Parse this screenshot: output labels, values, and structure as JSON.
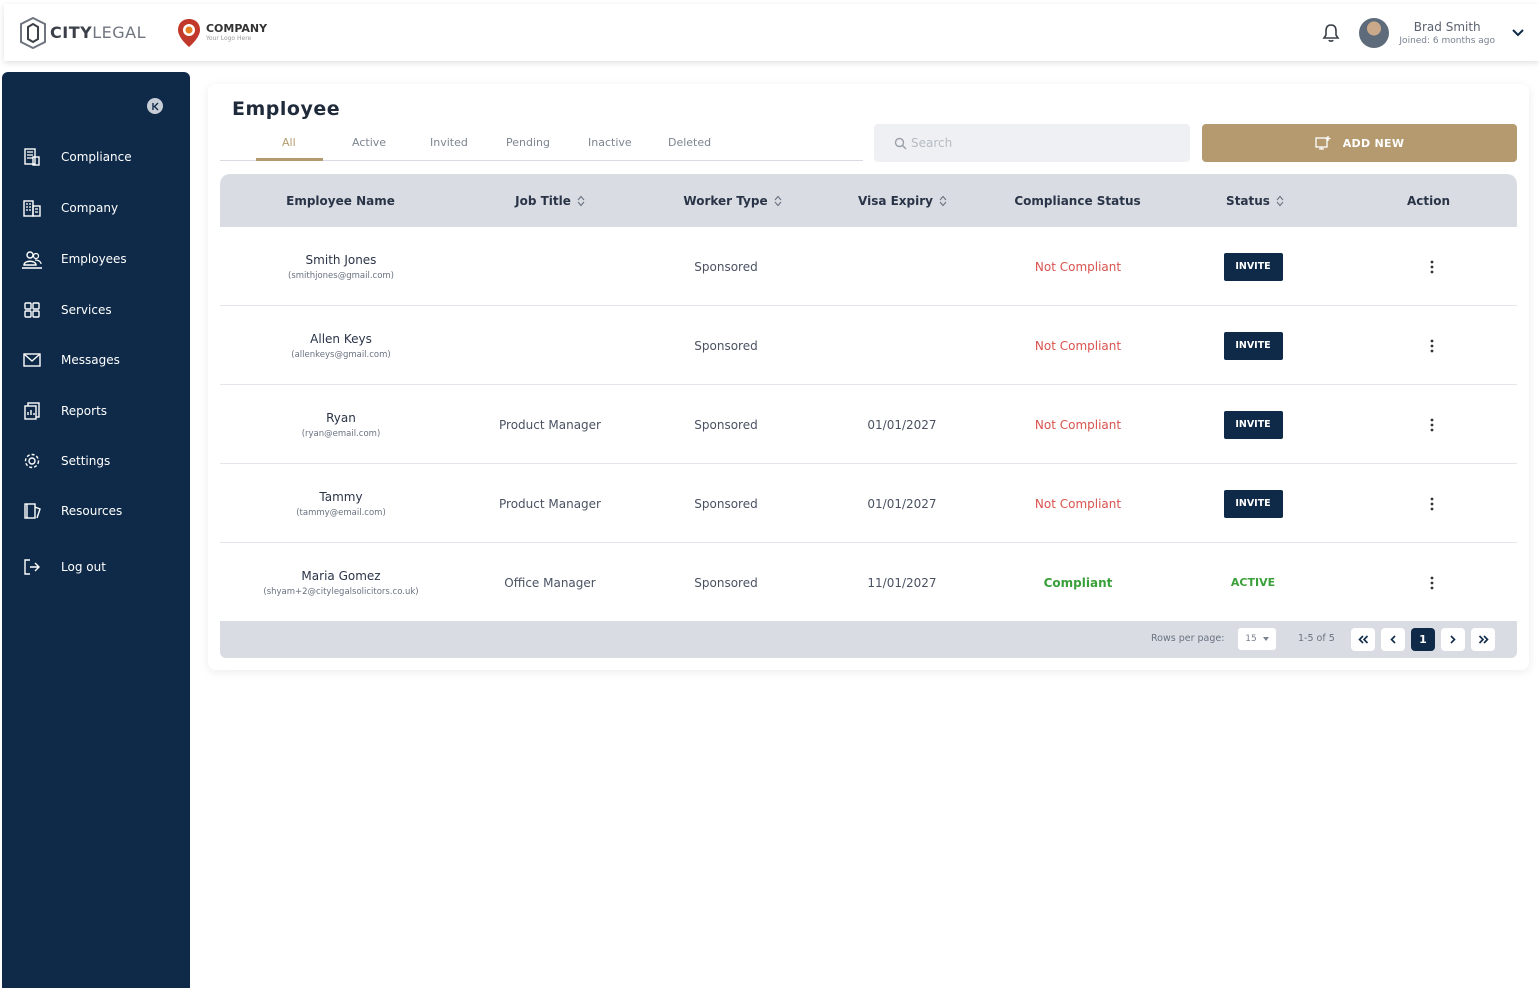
{
  "brand": {
    "name_bold": "CITY",
    "name_light": "LEGAL"
  },
  "company": {
    "name": "COMPANY",
    "tagline": "Your Logo Here"
  },
  "user": {
    "name": "Brad Smith",
    "joined": "Joined: 6 months ago"
  },
  "sidebar": {
    "items": [
      {
        "label": "Compliance",
        "icon": "compliance-icon"
      },
      {
        "label": "Company",
        "icon": "building-icon"
      },
      {
        "label": "Employees",
        "icon": "users-icon"
      },
      {
        "label": "Services",
        "icon": "grid-icon"
      },
      {
        "label": "Messages",
        "icon": "envelope-icon"
      },
      {
        "label": "Reports",
        "icon": "report-icon"
      },
      {
        "label": "Settings",
        "icon": "gear-icon"
      },
      {
        "label": "Resources",
        "icon": "book-icon"
      },
      {
        "label": "Log out",
        "icon": "logout-icon"
      }
    ],
    "active": "Employees"
  },
  "main": {
    "title": "Employee",
    "tabs": [
      {
        "label": "All"
      },
      {
        "label": "Active"
      },
      {
        "label": "Invited"
      },
      {
        "label": "Pending"
      },
      {
        "label": "Inactive"
      },
      {
        "label": "Deleted"
      }
    ],
    "active_tab": "All",
    "search": {
      "placeholder": "Search",
      "value": ""
    },
    "add_button": "ADD NEW"
  },
  "table": {
    "headers": [
      "Employee Name",
      "Job Title",
      "Worker Type",
      "Visa Expiry",
      "Compliance Status",
      "Status",
      "Action"
    ],
    "rows": [
      {
        "name": "Smith Jones",
        "email": "(smithjones@gmail.com)",
        "job_title": "",
        "worker_type": "Sponsored",
        "visa_expiry": "",
        "compliance": "Not Compliant",
        "status": "INVITE"
      },
      {
        "name": "Allen Keys",
        "email": "(allenkeys@gmail.com)",
        "job_title": "",
        "worker_type": "Sponsored",
        "visa_expiry": "",
        "compliance": "Not Compliant",
        "status": "INVITE"
      },
      {
        "name": "Ryan",
        "email": "(ryan@email.com)",
        "job_title": "Product Manager",
        "worker_type": "Sponsored",
        "visa_expiry": "01/01/2027",
        "compliance": "Not Compliant",
        "status": "INVITE"
      },
      {
        "name": "Tammy",
        "email": "(tammy@email.com)",
        "job_title": "Product Manager",
        "worker_type": "Sponsored",
        "visa_expiry": "01/01/2027",
        "compliance": "Not Compliant",
        "status": "INVITE"
      },
      {
        "name": "Maria Gomez",
        "email": "(shyam+2@citylegalsolicitors.co.uk)",
        "job_title": "Office Manager",
        "worker_type": "Sponsored",
        "visa_expiry": "11/01/2027",
        "compliance": "Compliant",
        "status": "ACTIVE"
      }
    ]
  },
  "pagination": {
    "rows_per_page_label": "Rows per page:",
    "rows_per_page": "15",
    "range": "1-5 of 5",
    "current_page": "1"
  },
  "colors": {
    "sidebar_bg": "#0e2a48",
    "accent_gold": "#b49a6e",
    "not_compliant": "#d9534f",
    "compliant": "#3aa03a"
  }
}
